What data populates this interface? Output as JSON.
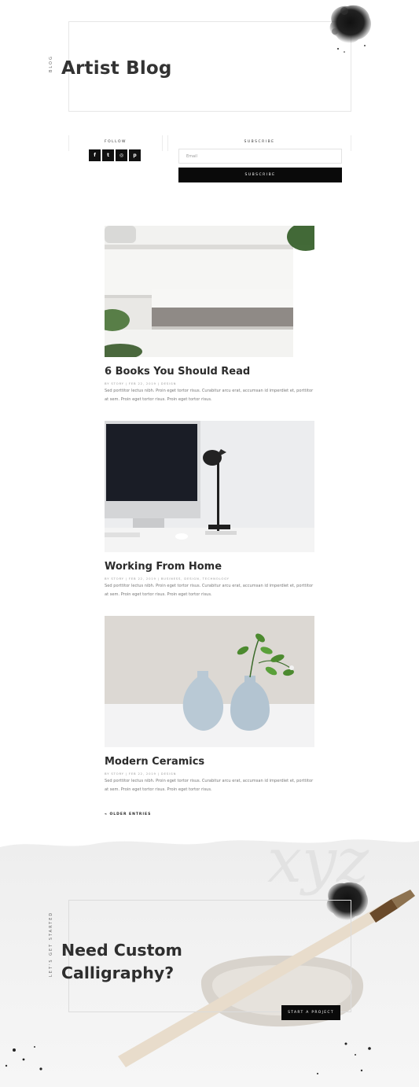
{
  "header": {
    "side_label": "BLOG",
    "title": "Artist Blog"
  },
  "follow": {
    "label": "FOLLOW",
    "socials": [
      {
        "icon": "facebook-icon",
        "glyph": "f"
      },
      {
        "icon": "twitter-icon",
        "glyph": "t"
      },
      {
        "icon": "instagram-icon",
        "glyph": "◎"
      },
      {
        "icon": "pinterest-icon",
        "glyph": "p"
      }
    ]
  },
  "subscribe": {
    "label": "SUBSCRIBE",
    "email_placeholder": "Email",
    "button_label": "SUBSCRIBE"
  },
  "posts": [
    {
      "title": "6 Books You Should Read",
      "meta": "BY STORY | FEB 22, 2019 | DESIGN",
      "excerpt": "Sed porttitor lectus nibh. Proin eget tortor risus. Curabitur arcu erat, accumsan id imperdiet et, porttitor at sem. Proin eget tortor risus. Proin eget tortor risus."
    },
    {
      "title": "Working From Home",
      "meta": "BY STORY | FEB 22, 2019 | BUSINESS, DESIGN, TECHNOLOGY",
      "excerpt": "Sed porttitor lectus nibh. Proin eget tortor risus. Curabitur arcu erat, accumsan id imperdiet et, porttitor at sem. Proin eget tortor risus. Proin eget tortor risus."
    },
    {
      "title": "Modern Ceramics",
      "meta": "BY STORY | FEB 22, 2019 | DESIGN",
      "excerpt": "Sed porttitor lectus nibh. Proin eget tortor risus. Curabitur arcu erat, accumsan id imperdiet et, porttitor at sem. Proin eget tortor risus. Proin eget tortor risus."
    }
  ],
  "pagination": {
    "older_label": "« OLDER ENTRIES"
  },
  "cta": {
    "side_label": "LET'S GET STARTED",
    "title_line1": "Need Custom",
    "title_line2": "Calligraphy?",
    "button_label": "START A PROJECT",
    "watermark": "xyz"
  }
}
